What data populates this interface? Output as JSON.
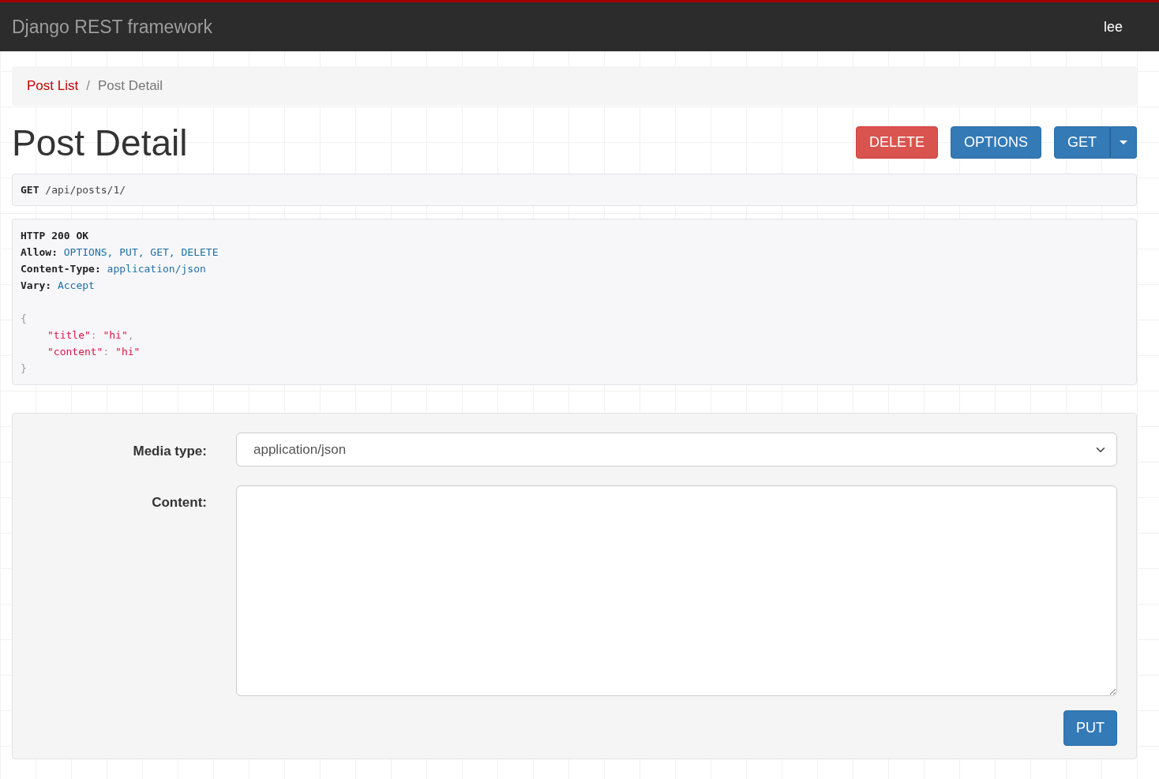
{
  "navbar": {
    "brand": "Django REST framework",
    "user": "lee"
  },
  "breadcrumb": [
    {
      "label": "Post List",
      "active": false
    },
    {
      "label": "Post Detail",
      "active": true
    }
  ],
  "breadcrumb_separator": "/",
  "page_title": "Post Detail",
  "buttons": [
    {
      "label": "DELETE",
      "kind": "danger"
    },
    {
      "label": "OPTIONS",
      "kind": "primary"
    },
    {
      "label": "GET",
      "kind": "split"
    }
  ],
  "request": {
    "method": "GET",
    "path": "/api/posts/1/"
  },
  "response": {
    "status_line": "HTTP 200 OK",
    "headers": [
      {
        "name": "Allow:",
        "value": "OPTIONS, PUT, GET, DELETE"
      },
      {
        "name": "Content-Type:",
        "value": "application/json"
      },
      {
        "name": "Vary:",
        "value": "Accept"
      }
    ],
    "body": [
      {
        "kind": "brace",
        "text": "{"
      },
      {
        "kind": "pair",
        "key": "\"title\"",
        "separator": ":",
        "value": "\"hi\"",
        "trailing": ","
      },
      {
        "kind": "pair",
        "key": "\"content\"",
        "separator": ":",
        "value": "\"hi\""
      },
      {
        "kind": "brace",
        "text": "}"
      }
    ]
  },
  "form": {
    "fields": [
      {
        "label": "Media type:",
        "kind": "select",
        "value": "application/json"
      },
      {
        "label": "Content:",
        "kind": "textarea"
      }
    ],
    "submit": "PUT"
  }
}
